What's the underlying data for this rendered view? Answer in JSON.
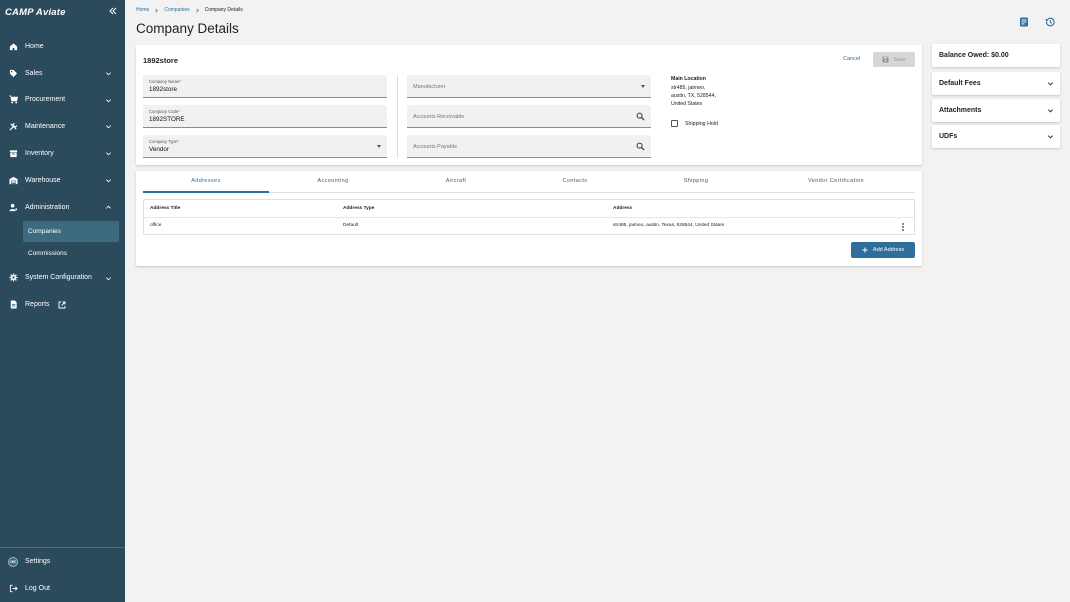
{
  "app": {
    "logo": "CAMP Aviate"
  },
  "sidebar": {
    "items": [
      {
        "label": "Home",
        "icon": "home-icon"
      },
      {
        "label": "Sales",
        "icon": "tag-icon"
      },
      {
        "label": "Procurement",
        "icon": "cart-icon"
      },
      {
        "label": "Maintenance",
        "icon": "wrench-icon"
      },
      {
        "label": "Inventory",
        "icon": "inventory-icon"
      },
      {
        "label": "Warehouse",
        "icon": "warehouse-icon"
      },
      {
        "label": "Administration",
        "icon": "admin-icon"
      },
      {
        "label": "System Configuration",
        "icon": "gear-icon"
      },
      {
        "label": "Reports",
        "icon": "report-icon"
      }
    ],
    "admin_sub": {
      "companies": "Companies",
      "commissions": "Commissions"
    },
    "settings": "Settings",
    "avatar_initials": "GE",
    "logout": "Log Out"
  },
  "breadcrumb": {
    "home": "Home",
    "companies": "Companies",
    "current": "Company Details"
  },
  "page": {
    "title": "Company Details"
  },
  "company": {
    "name": "1892store",
    "cancel": "Cancel",
    "save": "Save",
    "company_name_label": "Company Name*",
    "company_name_value": "1892store",
    "company_code_label": "Company Code*",
    "company_code_value": "1892STORE",
    "company_type_label": "Company Type*",
    "company_type_value": "Vendor",
    "manufacturer_placeholder": "Manufacturer",
    "accounts_receivable_placeholder": "Accounts Receivable",
    "accounts_payable_placeholder": "Accounts Payable",
    "main_location_title": "Main Location",
    "main_location_lines": [
      "str485, jairneo,",
      "austin, TX, 528544,",
      "United States"
    ],
    "shipping_hold_label": "Shipping Hold"
  },
  "tabs": [
    "Addresses",
    "Accounting",
    "Aircraft",
    "Contacts",
    "Shipping",
    "Vendor Certification"
  ],
  "addresses": {
    "columns": [
      "Address Title",
      "Address Type",
      "Address"
    ],
    "rows": [
      {
        "title": "office",
        "type": "Default",
        "address": "str485, jairneo, austin, Texas, 528544, United States"
      }
    ],
    "add_button": "Add Address"
  },
  "right_panels": {
    "balance": "Balance Owed: $0.00",
    "default_fees": "Default Fees",
    "attachments": "Attachments",
    "udfs": "UDFs"
  },
  "colors": {
    "sidebar": "#2b4a5c",
    "accent": "#2d6f9a",
    "active_sub": "#3e6a80"
  }
}
